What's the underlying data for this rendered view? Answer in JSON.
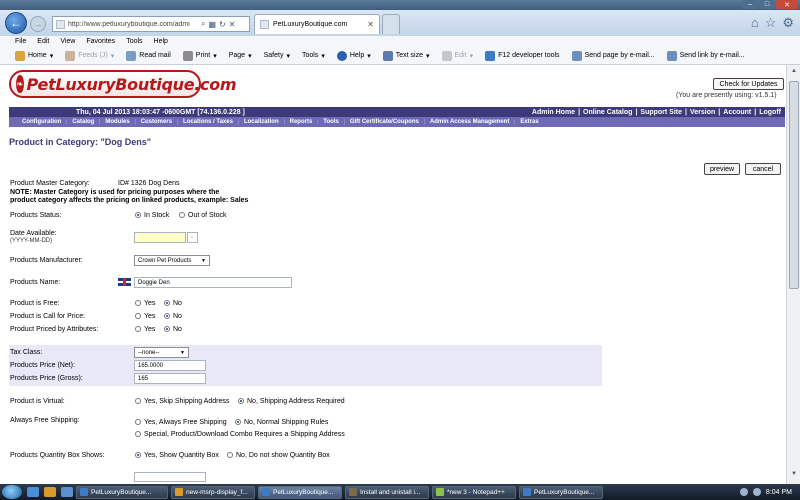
{
  "browser": {
    "url": "http://www.petluxuryboutique.com/admi",
    "active_tab": "PetLuxuryBoutique.com",
    "menu": [
      "File",
      "Edit",
      "View",
      "Favorites",
      "Tools",
      "Help"
    ],
    "toolbar": {
      "home": "Home",
      "feeds": "Feeds (J)",
      "read_mail": "Read mail",
      "print": "Print",
      "page": "Page",
      "safety": "Safety",
      "tools": "Tools",
      "help": "Help",
      "text_size": "Text size",
      "edit": "Edit",
      "f12": "F12 developer tools",
      "send_page": "Send page by e-mail...",
      "send_link": "Send link by e-mail..."
    }
  },
  "site": {
    "logo_text": "PetLuxuryBoutique.com",
    "check_updates": "Check for Updates",
    "version_note": "(You are presently using: v1.5.1)",
    "datetime": "Thu, 04 Jul 2013 18:03:47 -0600GMT [74.136.0.228 ]",
    "admin_links": [
      "Admin Home",
      "Online Catalog",
      "Support Site",
      "Version",
      "Account",
      "Logoff"
    ],
    "nav_tabs": [
      "Configuration",
      "Catalog",
      "Modules",
      "Customers",
      "Locations / Taxes",
      "Localization",
      "Reports",
      "Tools",
      "Gift Certificate/Coupons",
      "Admin Access Management",
      "Extras"
    ]
  },
  "page": {
    "title": "Product in Category: \"Dog Dens\"",
    "preview": "preview",
    "cancel": "cancel",
    "master_category_label": "Product Master Category:",
    "master_category_value": "ID# 1326 Dog Dens",
    "note_line1": "NOTE: Master Category is used for pricing purposes where the",
    "note_line2": "product category affects the pricing on linked products, example: Sales",
    "status_label": "Products Status:",
    "status_options": [
      "In Stock",
      "Out of Stock"
    ],
    "date_label": "Date Available:",
    "date_format": "(YYYY-MM-DD)",
    "manufacturer_label": "Products Manufacturer:",
    "manufacturer_value": "Crown Pet Products",
    "name_label": "Products Name:",
    "name_value": "Doggie Den",
    "free_label": "Product is Free:",
    "call_label": "Product is Call for Price:",
    "attr_label": "Product Priced by Attributes:",
    "yes": "Yes",
    "no": "No",
    "tax_label": "Tax Class:",
    "tax_value": "--none--",
    "price_net_label": "Products Price (Net):",
    "price_net_value": "165.0000",
    "price_gross_label": "Products Price (Gross):",
    "price_gross_value": "165",
    "virtual_label": "Product is Virtual:",
    "virtual_yes": "Yes, Skip Shipping Address",
    "virtual_no": "No, Shipping Address Required",
    "free_ship_label": "Always Free Shipping:",
    "free_ship_yes": "Yes, Always Free Shipping",
    "free_ship_no": "No, Normal Shipping Rules",
    "free_ship_special": "Special, Product/Download Combo Requires a Shipping Address",
    "qty_box_label": "Products Quantity Box Shows:",
    "qty_yes": "Yes, Show Quantity Box",
    "qty_no": "No, Do not show Quantity Box"
  },
  "taskbar": {
    "tasks": [
      "PetLuxuryBoutique...",
      "new-msrp-display_f...",
      "PetLuxuryBoutique...",
      "Install and unistall i...",
      "*new 3 - Notepad++",
      "PetLuxuryBoutique..."
    ],
    "clock": "8:04 PM"
  }
}
